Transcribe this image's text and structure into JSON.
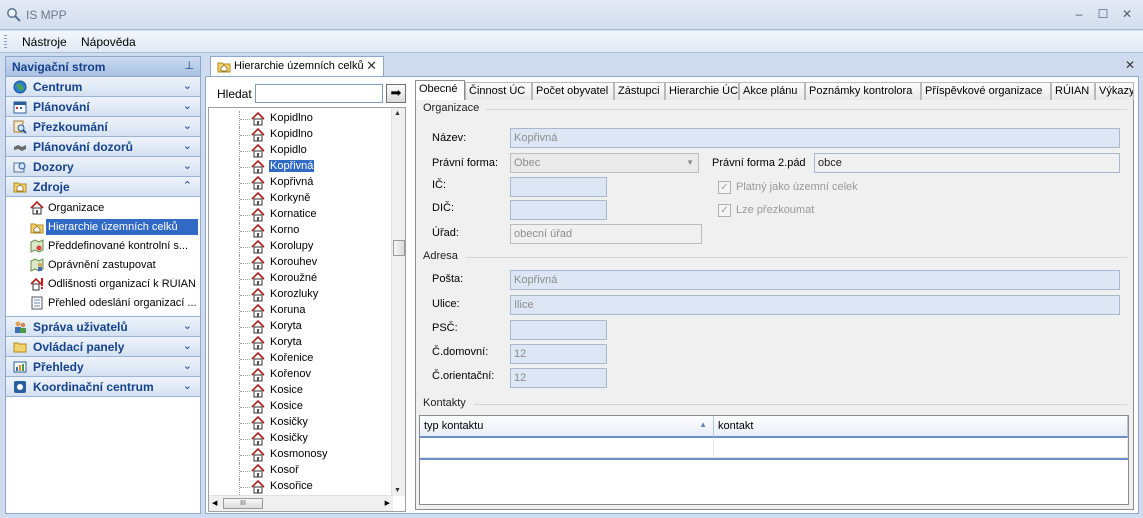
{
  "window": {
    "title": "IS MPP",
    "min_symbol": "‒",
    "max_symbol": "☐",
    "close_symbol": "✕"
  },
  "menu": {
    "items": [
      "Nástroje",
      "Nápověda"
    ]
  },
  "nav": {
    "title": "Navigační strom",
    "pin_symbol": "⊥",
    "groups_top": [
      {
        "label": "Centrum",
        "icon": "globe-icon"
      },
      {
        "label": "Plánování",
        "icon": "calendar-icon"
      },
      {
        "label": "Přezkoumání",
        "icon": "magnifier-icon"
      },
      {
        "label": "Plánování dozorů",
        "icon": "handshake-icon"
      },
      {
        "label": "Dozory",
        "icon": "inspect-icon"
      },
      {
        "label": "Zdroje",
        "icon": "folder-icon"
      }
    ],
    "zdroje_items": [
      {
        "label": "Organizace",
        "icon": "house-icon"
      },
      {
        "label": "Hierarchie územních celků",
        "icon": "house-folder-icon"
      },
      {
        "label": "Předdefinované kontrolní s...",
        "icon": "map-icon"
      },
      {
        "label": "Oprávnění zastupovat",
        "icon": "map-person-icon"
      },
      {
        "label": "Odlišnosti organizací k RÚIAN",
        "icon": "house-warning-icon"
      },
      {
        "label": "Přehled odeslání organizací ...",
        "icon": "document-icon"
      }
    ],
    "groups_bottom": [
      {
        "label": "Správa uživatelů",
        "icon": "users-icon"
      },
      {
        "label": "Ovládací panely",
        "icon": "folder-icon"
      },
      {
        "label": "Přehledy",
        "icon": "report-icon"
      },
      {
        "label": "Koordinační centrum",
        "icon": "network-icon"
      }
    ],
    "collapse_symbol": "⌄",
    "expand_symbol": "⌃"
  },
  "doc": {
    "tab_label": "Hierarchie územních celků",
    "close_symbol": "✕"
  },
  "search": {
    "label": "Hledat",
    "value": "",
    "go_symbol": "➡"
  },
  "tree": {
    "items": [
      "Kopidlno",
      "Kopidlno",
      "Kopidlo",
      "Kopřivná",
      "Kopřivná",
      "Korkyně",
      "Kornatice",
      "Korno",
      "Korolupy",
      "Korouhev",
      "Koroužné",
      "Korozluky",
      "Koruna",
      "Koryta",
      "Koryta",
      "Kořenice",
      "Kořenov",
      "Kosice",
      "Kosice",
      "Kosičky",
      "Kosičky",
      "Kosmonosy",
      "Kosoř",
      "Kosořice"
    ],
    "selected_index": 3,
    "hscroll_label": "III"
  },
  "detail": {
    "tabs": [
      "Obecné",
      "Činnost ÚC",
      "Počet obyvatel",
      "Zástupci",
      "Hierarchie ÚC",
      "Akce plánu",
      "Poznámky kontrolora",
      "Příspěvkové organizace",
      "RÚIAN",
      "Výkazy"
    ],
    "active_tab": 0,
    "organizace": {
      "title": "Organizace",
      "nazev_label": "Název:",
      "nazev_value": "Kopřivná",
      "pravni_forma_label": "Právní forma:",
      "pravni_forma_value": "Obec",
      "pravni_forma2_label": "Právní forma 2.pád",
      "pravni_forma2_value": "obce",
      "ic_label": "IČ:",
      "ic_value": "",
      "dic_label": "DIČ:",
      "dic_value": "",
      "urad_label": "Úřad:",
      "urad_value": "obecní úřad",
      "platny_label": "Platný jako územní celek",
      "lze_label": "Lze přezkoumat",
      "check_symbol": "✓"
    },
    "adresa": {
      "title": "Adresa",
      "posta_label": "Pošta:",
      "posta_value": "Kopřivná",
      "ulice_label": "Ulice:",
      "ulice_value": "Ilice",
      "psc_label": "PSČ:",
      "psc_value": "",
      "cdomovni_label": "Č.domovní:",
      "cdomovni_value": "12",
      "corientacni_label": "Č.orientační:",
      "corientacni_value": "12"
    },
    "kontakty": {
      "title": "Kontakty",
      "columns": [
        "typ kontaktu",
        "kontakt"
      ],
      "sort_symbol": "▲"
    }
  },
  "colors": {
    "accent": "#15428b",
    "selection": "#316ac5",
    "panel": "#cfdcef"
  }
}
